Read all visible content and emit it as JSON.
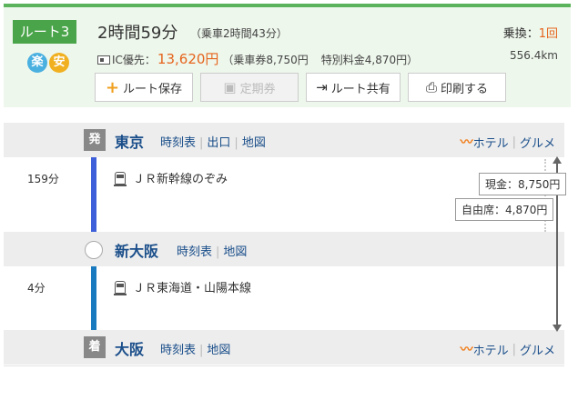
{
  "header": {
    "route_label": "ルート3",
    "badge_raku": "楽",
    "badge_an": "安",
    "total_time": "2時間59分",
    "ride_time": "（乗車2時間43分）",
    "ic_label": "IC優先：",
    "fare_total": "13,620円",
    "fare_ticket": "（乗車券8,750円",
    "fare_extra": "特別料金4,870円）",
    "transfer_label": "乗換：",
    "transfer_count": "1回",
    "distance": "556.4km"
  },
  "buttons": {
    "save": "ルート保存",
    "commuter": "定期券",
    "share": "ルート共有",
    "print": "印刷する"
  },
  "stations": [
    {
      "marker": "発",
      "name": "東京",
      "links": [
        "時刻表",
        "出口",
        "地図"
      ],
      "hotel": "ホテル",
      "gourmet": "グルメ"
    },
    {
      "marker": "",
      "name": "新大阪",
      "links": [
        "時刻表",
        "地図"
      ]
    },
    {
      "marker": "着",
      "name": "大阪",
      "links": [
        "時刻表",
        "地図"
      ],
      "hotel": "ホテル",
      "gourmet": "グルメ"
    }
  ],
  "segments": [
    {
      "duration": "159分",
      "train": "ＪＲ新幹線のぞみ"
    },
    {
      "duration": "4分",
      "train": "ＪＲ東海道・山陽本線"
    }
  ],
  "fares": {
    "cash": "現金：8,750円",
    "reserved": "自由席：4,870円"
  },
  "colors": {
    "accent_green": "#4aa44a",
    "fare_orange": "#e5641d",
    "link_blue": "#1a4e8a",
    "shinkansen_line": "#3d5fd9",
    "local_line": "#1a7abf"
  }
}
